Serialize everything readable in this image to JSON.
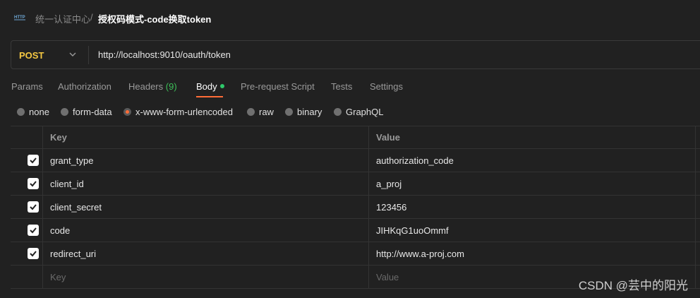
{
  "breadcrumb": {
    "parent": "统一认证中心",
    "separator": "/",
    "current": "授权码模式-code换取token",
    "icon": "http-icon"
  },
  "request": {
    "method": "POST",
    "url": "http://localhost:9010/oauth/token",
    "method_color": "#f5c842"
  },
  "tabs": [
    {
      "label": "Params"
    },
    {
      "label": "Authorization"
    },
    {
      "label": "Headers",
      "count": "(9)"
    },
    {
      "label": "Body",
      "active": true
    },
    {
      "label": "Pre-request Script"
    },
    {
      "label": "Tests"
    },
    {
      "label": "Settings"
    }
  ],
  "body_types": [
    {
      "label": "none"
    },
    {
      "label": "form-data"
    },
    {
      "label": "x-www-form-urlencoded",
      "selected": true
    },
    {
      "label": "raw"
    },
    {
      "label": "binary"
    },
    {
      "label": "GraphQL"
    }
  ],
  "table": {
    "headers": {
      "key": "Key",
      "value": "Value"
    },
    "rows": [
      {
        "checked": true,
        "key": "grant_type",
        "value": "authorization_code"
      },
      {
        "checked": true,
        "key": "client_id",
        "value": "a_proj"
      },
      {
        "checked": true,
        "key": "client_secret",
        "value": "123456"
      },
      {
        "checked": true,
        "key": "code",
        "value": "JIHKqG1uoOmmf"
      },
      {
        "checked": true,
        "key": "redirect_uri",
        "value": "http://www.a-proj.com"
      }
    ],
    "placeholder": {
      "key": "Key",
      "value": "Value"
    }
  },
  "watermark": "CSDN @芸中的阳光",
  "colors": {
    "accent": "#ff6c37",
    "active_dot": "#2fc96b",
    "headers_count": "#3dbf59"
  }
}
